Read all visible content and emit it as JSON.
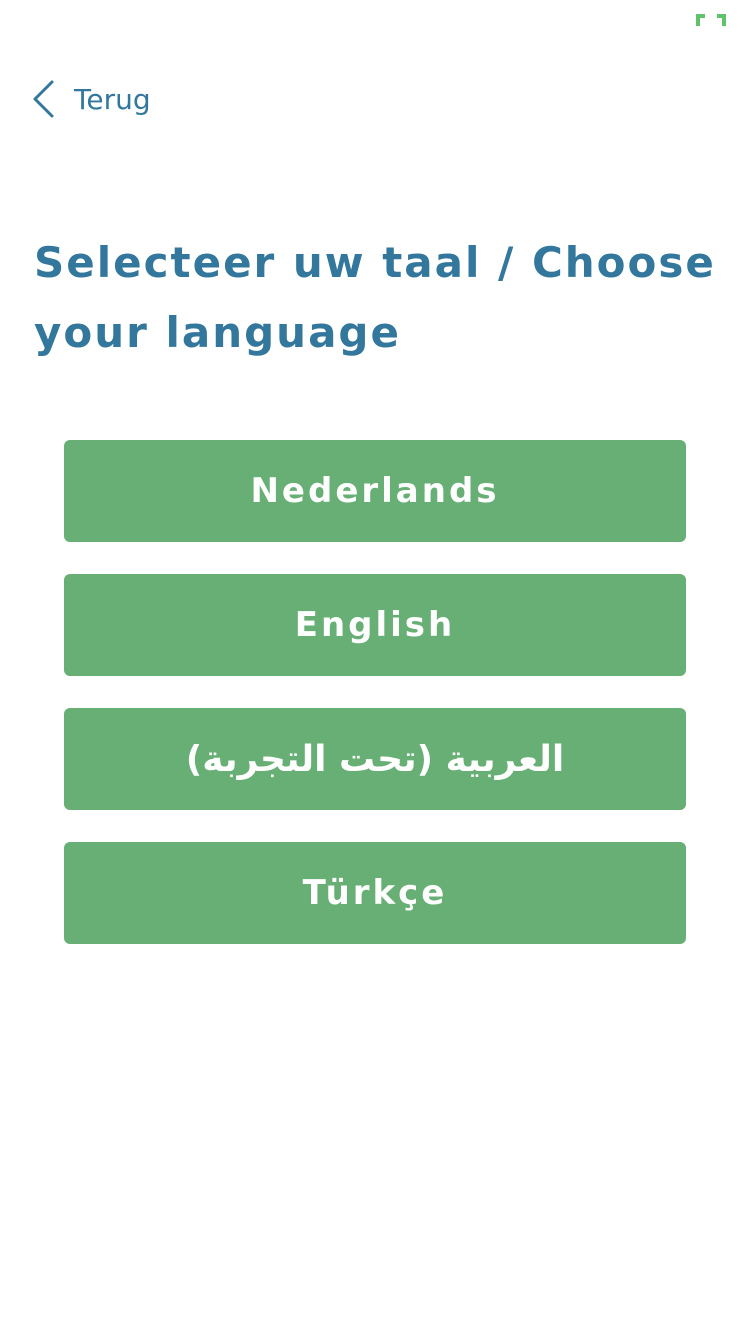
{
  "header": {
    "back_label": "Terug"
  },
  "title": "Selecteer uw taal / Choose your language",
  "languages": [
    {
      "label": "Nederlands",
      "icon": ""
    },
    {
      "label": "English"
    },
    {
      "label": "العربية (تحت التجربة)"
    },
    {
      "label": "Türkçe"
    }
  ],
  "colors": {
    "accent": "#34779d",
    "button": "#67af74",
    "status": "#5fc36a"
  },
  "icons": {
    "back": "chevron-left-icon",
    "status": "fullscreen-icon"
  }
}
